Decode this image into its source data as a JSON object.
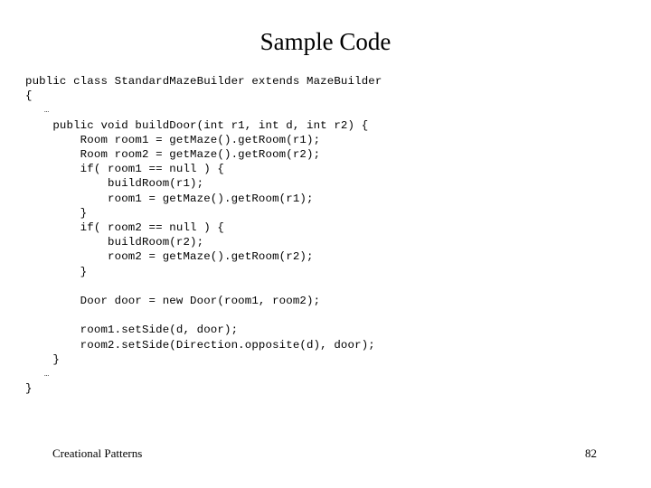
{
  "slide": {
    "title": "Sample Code",
    "background_color": "#ffffff",
    "text_color": "#000000",
    "code_lines": [
      "public class StandardMazeBuilder extends MazeBuilder",
      "{",
      "    …",
      "    public void buildDoor(int r1, int d, int r2) {",
      "        Room room1 = getMaze().getRoom(r1);",
      "        Room room2 = getMaze().getRoom(r2);",
      "        if( room1 == null ) {",
      "            buildRoom(r1);",
      "            room1 = getMaze().getRoom(r1);",
      "        }",
      "        if( room2 == null ) {",
      "            buildRoom(r2);",
      "            room2 = getMaze().getRoom(r2);",
      "        }",
      "",
      "        Door door = new Door(room1, room2);",
      "",
      "        room1.setSide(d, door);",
      "        room2.setSide(Direction.opposite(d), door);",
      "    }",
      "    …",
      "}"
    ],
    "footer": {
      "section_title": "Creational Patterns",
      "page_number": "82"
    }
  }
}
